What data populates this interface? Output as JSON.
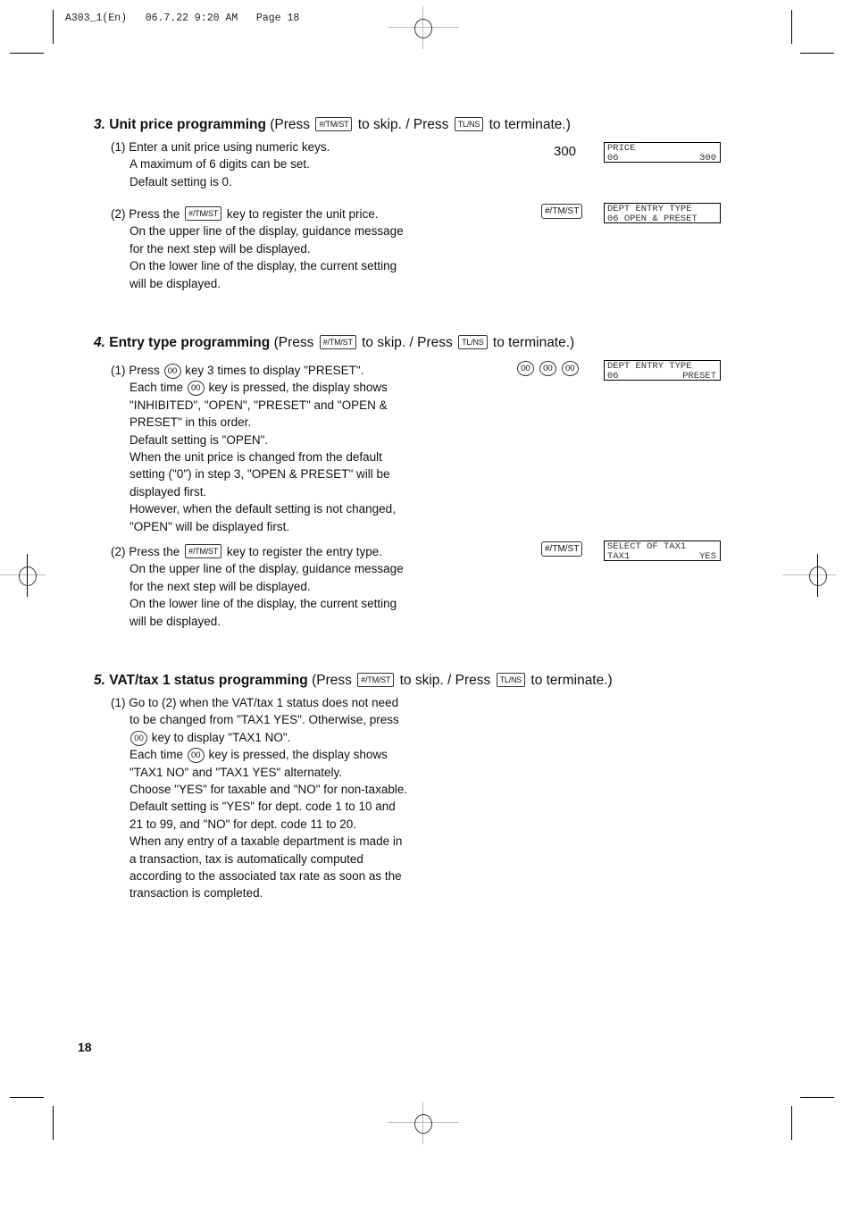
{
  "slug": "A303_1(En)   06.7.22 9:20 AM   Page 18",
  "page_number": "18",
  "keys": {
    "skip": "#/TM/ST",
    "terminate": "TL/NS",
    "zero": "00"
  },
  "sections": [
    {
      "number": "3.",
      "title": "Unit price programming",
      "press": "(Press",
      "to_skip": "to skip. / Press",
      "to_terminate": "to terminate.)",
      "steps": [
        {
          "lines": [
            "(1) Enter a unit price using numeric keys.",
            "A maximum of 6 digits can be set.",
            "Default setting is 0."
          ],
          "key_input": "300",
          "display": {
            "upper": "PRICE",
            "lower_left": "06",
            "lower_right": "300"
          }
        },
        {
          "lines_pre": "(2) Press the",
          "lines_post": "key to register the unit price.",
          "lines": [
            "On the upper line of the display, guidance message",
            "for the next step will be displayed.",
            "On the lower line of the display, the current setting",
            "will be displayed."
          ],
          "key_input": "#/TM/ST",
          "display": {
            "upper": "DEPT ENTRY TYPE",
            "lower_left": "06 OPEN & PRESET",
            "lower_right": ""
          }
        }
      ]
    },
    {
      "number": "4.",
      "title": "Entry type programming",
      "press": "(Press",
      "to_skip": "to skip. / Press",
      "to_terminate": "to terminate.)",
      "steps": [
        {
          "line1_pre": "(1) Press",
          "line1_post": "key 3 times to display \"PRESET\".",
          "line2_pre": "Each time",
          "line2_post": "key is pressed, the display shows",
          "lines": [
            "\"INHIBITED\", \"OPEN\", \"PRESET\" and \"OPEN &",
            "PRESET\" in this order.",
            "Default setting is \"OPEN\".",
            "When the unit price is changed from the default",
            "setting (\"0\") in step 3, \"OPEN & PRESET\" will be",
            "displayed first.",
            "However, when the default setting is not changed,",
            "\"OPEN\" will be displayed first."
          ],
          "key_input": [
            "00",
            "00",
            "00"
          ],
          "display": {
            "upper": "DEPT ENTRY TYPE",
            "lower_left": "06",
            "lower_right": "PRESET"
          }
        },
        {
          "lines_pre": "(2) Press the",
          "lines_post": "key to register the entry type.",
          "lines": [
            "On the upper line of the display, guidance message",
            "for the next step will be displayed.",
            "On the lower line of the display, the current setting",
            "will be displayed."
          ],
          "key_input": "#/TM/ST",
          "display": {
            "upper": "SELECT OF TAX1",
            "lower_left": "TAX1",
            "lower_right": "YES"
          }
        }
      ]
    },
    {
      "number": "5.",
      "title": "VAT/tax 1 status programming",
      "press": "(Press",
      "to_skip": "to skip. / Press",
      "to_terminate": "to terminate.)",
      "steps": [
        {
          "line1": "(1) Go to (2) when the VAT/tax 1 status does not need",
          "line2": "to be changed from \"TAX1 YES\".  Otherwise, press",
          "line3_post": "key to display \"TAX1 NO\".",
          "line4_pre": "Each time",
          "line4_post": "key is pressed, the display shows",
          "lines": [
            "\"TAX1 NO\" and \"TAX1 YES\" alternately.",
            "Choose \"YES\" for taxable and \"NO\" for non-taxable.",
            "Default setting is \"YES\" for dept. code 1 to 10 and",
            "21 to 99, and \"NO\" for dept. code 11 to 20.",
            "When any entry of a taxable department is made in",
            "a transaction, tax is automatically computed",
            "according to the associated tax rate as soon as the",
            "transaction is completed."
          ]
        }
      ]
    }
  ]
}
